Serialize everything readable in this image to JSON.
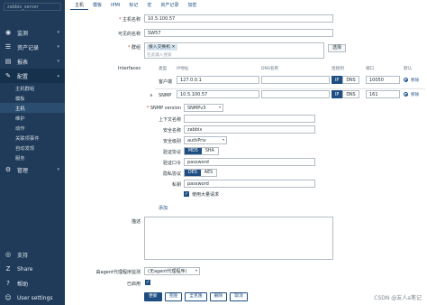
{
  "sidebar": {
    "server": "zabbix_server",
    "items": [
      {
        "label": "监测",
        "icon": "eye-icon"
      },
      {
        "label": "资产记录",
        "icon": "list-icon"
      },
      {
        "label": "报表",
        "icon": "chart-icon"
      },
      {
        "label": "配置",
        "icon": "wrench-icon"
      }
    ],
    "subitems": [
      "主机群组",
      "模板",
      "主机",
      "维护",
      "动作",
      "关联项事件",
      "自动发现",
      "服务"
    ],
    "admin": {
      "label": "管理",
      "icon": "gear-icon"
    },
    "bottom": [
      {
        "label": "支持",
        "icon": "support-icon"
      },
      {
        "label": "Share",
        "icon": "share-icon"
      },
      {
        "label": "帮助",
        "icon": "help-icon"
      },
      {
        "label": "User settings",
        "icon": "user-icon"
      }
    ]
  },
  "tabs": [
    "主机",
    "模板",
    "IPMI",
    "标记",
    "宏",
    "资产记录",
    "加密"
  ],
  "form": {
    "host_name_label": "主机名称",
    "host_name": "10.5.100.57",
    "visible_name_label": "可见的名称",
    "visible_name": "SW57",
    "groups_label": "群组",
    "group_chip": "接入交换机",
    "group_placeholder": "在此输入搜索",
    "select_btn": "选择",
    "interfaces_label": "Interfaces",
    "col_type": "类型",
    "col_ip": "IP地址",
    "col_dns": "DNS名称",
    "col_connect": "连接到",
    "col_port": "端口",
    "col_default": "默认",
    "agent_type": "客户端",
    "agent_ip": "127.0.0.1",
    "agent_port": "10050",
    "snmp_type": "SNMP",
    "snmp_ip": "10.5.100.57",
    "snmp_port": "161",
    "ip_label": "IP",
    "dns_label": "DNS",
    "remove": "移除",
    "snmp_version_label": "SNMP version",
    "snmp_version": "SNMPv3",
    "context_label": "上下文名称",
    "security_name_label": "安全名称",
    "security_name": "zabbix",
    "security_level_label": "安全级别",
    "security_level": "authPriv",
    "auth_protocol_label": "验证协议",
    "auth_md5": "MD5",
    "auth_sha": "SHA",
    "auth_pass_label": "验证口令",
    "auth_pass": "password",
    "priv_protocol_label": "隐私协议",
    "priv_des": "DES",
    "priv_aes": "AES",
    "priv_key_label": "私钥",
    "priv_key": "password",
    "bulk_label": "使用大量请求",
    "add_link": "添加",
    "description_label": "描述",
    "proxy_label": "由agent代理程序监测",
    "proxy_value": "(无agent代理程序)",
    "enabled_label": "已启用",
    "actions": [
      "更新",
      "克隆",
      "全克隆",
      "删除",
      "取消"
    ]
  },
  "watermark": "CSDN @友人a笔记"
}
